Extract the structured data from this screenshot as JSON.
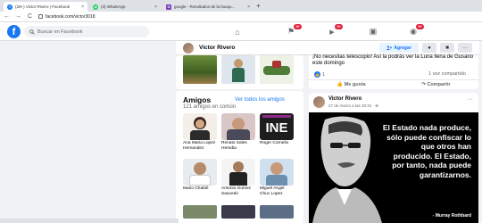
{
  "browser": {
    "tabs": [
      {
        "title": "(28+) Victor Rivero | Facebook",
        "close": "×",
        "favicon": "f",
        "color": "#1877f2"
      },
      {
        "title": "(3) WhatsApp",
        "close": "×",
        "favicon": "w",
        "color": "#25d366"
      },
      {
        "title": "google - Resultados de la busqu...",
        "close": "×",
        "favicon": "G",
        "color": "#7b3fbf"
      }
    ],
    "new_tab": "+",
    "back": "←",
    "forward": "→",
    "reload": "C",
    "url": "facebook.com/victor3018"
  },
  "fbnav": {
    "logo": "f",
    "search_placeholder": "Buscar en Facebook",
    "icons": [
      {
        "name": "home-icon",
        "glyph": "⌂",
        "badge": ""
      },
      {
        "name": "flag-icon",
        "glyph": "⚑",
        "badge": "9+"
      },
      {
        "name": "video-icon",
        "glyph": "▶",
        "badge": "9+"
      },
      {
        "name": "marketplace-icon",
        "glyph": "▣",
        "badge": ""
      },
      {
        "name": "groups-icon",
        "glyph": "◉",
        "badge": "9+"
      }
    ]
  },
  "profile": {
    "name": "Victor Rivero",
    "add_label": "Agregar",
    "messenger_glyph": "●",
    "camera_glyph": "■",
    "more_glyph": "···"
  },
  "friends": {
    "title": "Amigos",
    "see_all": "Ver todos los amigos",
    "subtitle": "121 amigos en común",
    "list": [
      {
        "name": "Ana Maria Lopez Hernandez"
      },
      {
        "name": "Renato Sales Heredia"
      },
      {
        "name": "Roger Cornelio"
      },
      {
        "name": "Mario Chablé"
      },
      {
        "name": "Antonio Gomez Saucedo"
      },
      {
        "name": "Miguel Angel Chuc Lopez"
      }
    ],
    "ine_logo": "INE"
  },
  "post1": {
    "text": "¡No necesitas telescopio! Así la podrás ver la Luna llena de Gusano este domingo",
    "likes": "1",
    "shares": "1 vez compartido",
    "like_label": "Me gusta",
    "share_label": "Compartir"
  },
  "post2": {
    "author": "Victor Rivero",
    "time": "27 de marzo a las 20:31 · ⊕",
    "more": "···",
    "quote": "El Estado nada produce, sólo puede confiscar lo que otros han producido. El Estado, por tanto, nada puede garantizarnos.",
    "quote_author": "- Murray Rothbard"
  }
}
